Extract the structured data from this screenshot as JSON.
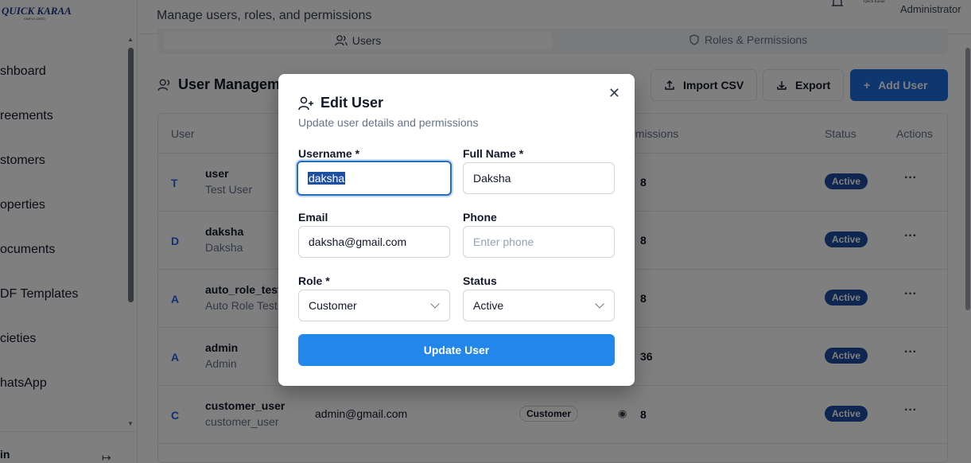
{
  "brand": {
    "logo_text": "QUICK KARAAR",
    "logo_sub": "SIMPLE DEED"
  },
  "sidebar": {
    "items": [
      {
        "label": "shboard"
      },
      {
        "label": "reements"
      },
      {
        "label": "stomers"
      },
      {
        "label": "operties"
      },
      {
        "label": "ocuments"
      },
      {
        "label": "DF Templates"
      },
      {
        "label": "cieties"
      },
      {
        "label": "hatsApp"
      }
    ],
    "footer_label": "in"
  },
  "header": {
    "subtitle": "Manage users, roles, and permissions",
    "user_role": "Administrator",
    "user_logo": "Quick Karaar"
  },
  "tabs": [
    {
      "label": "Users"
    },
    {
      "label": "Roles & Permissions"
    }
  ],
  "section": {
    "title": "User Management"
  },
  "toolbar": {
    "import_label": "Import CSV",
    "export_label": "Export",
    "add_label": "Add User"
  },
  "table": {
    "columns": {
      "user": "User",
      "permissions": "Permissions",
      "status": "Status",
      "actions": "Actions"
    },
    "rows": [
      {
        "initial": "T",
        "username": "user",
        "full_name": "Test User",
        "email": "",
        "role": "",
        "permissions": "8",
        "status": "Active"
      },
      {
        "initial": "D",
        "username": "daksha",
        "full_name": "Daksha",
        "email": "",
        "role": "",
        "permissions": "8",
        "status": "Active"
      },
      {
        "initial": "A",
        "username": "auto_role_test",
        "full_name": "Auto Role Test",
        "email": "",
        "role": "",
        "permissions": "8",
        "status": "Active"
      },
      {
        "initial": "A",
        "username": "admin",
        "full_name": "Admin",
        "email": "",
        "role": "",
        "permissions": "36",
        "status": "Active"
      },
      {
        "initial": "C",
        "username": "customer_user",
        "full_name": "customer_user",
        "email": "admin@gmail.com",
        "role": "Customer",
        "permissions": "8",
        "status": "Active"
      }
    ]
  },
  "modal": {
    "title": "Edit User",
    "description": "Update user details and permissions",
    "fields": {
      "username": {
        "label": "Username *",
        "value": "daksha"
      },
      "full_name": {
        "label": "Full Name *",
        "value": "Daksha"
      },
      "email": {
        "label": "Email",
        "value": "daksha@gmail.com"
      },
      "phone": {
        "label": "Phone",
        "value": "",
        "placeholder": "Enter phone"
      },
      "role": {
        "label": "Role *",
        "value": "Customer"
      },
      "status": {
        "label": "Status",
        "value": "Active"
      }
    },
    "submit_label": "Update User",
    "close_glyph": "✕"
  },
  "colors": {
    "primary": "#2386ea",
    "status_badge": "#1e4fa1",
    "overlay": "rgba(0,0,0,0.5)"
  }
}
